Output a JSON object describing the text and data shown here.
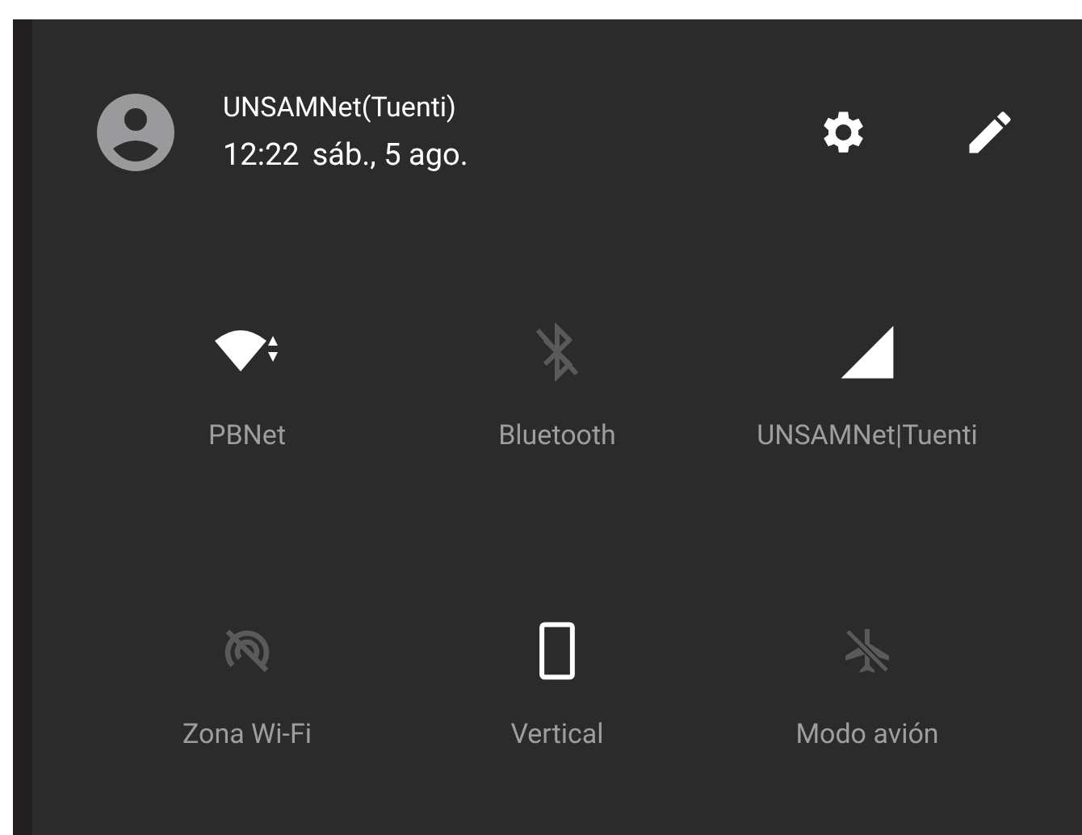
{
  "header": {
    "network_name": "UNSAMNet(Tuenti)",
    "time": "12:22",
    "date": "sáb., 5 ago."
  },
  "tiles": [
    {
      "kind": "wifi",
      "label": "PBNet",
      "on": true
    },
    {
      "kind": "bluetooth",
      "label": "Bluetooth",
      "on": false
    },
    {
      "kind": "cellular",
      "label": "UNSAMNet|Tuenti",
      "on": true
    },
    {
      "kind": "hotspot",
      "label": "Zona Wi-Fi",
      "on": false
    },
    {
      "kind": "rotation",
      "label": "Vertical",
      "on": true
    },
    {
      "kind": "airplane",
      "label": "Modo avión",
      "on": false
    }
  ]
}
